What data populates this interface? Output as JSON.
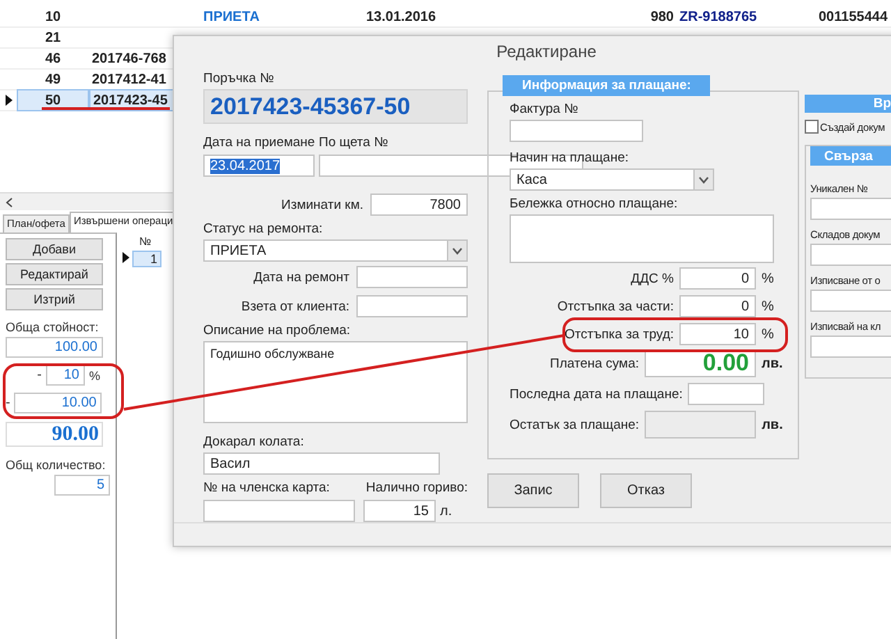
{
  "orders_table": {
    "rows": [
      {
        "number": "10",
        "status": "ПРИЕТА",
        "date": "13.01.2016",
        "column_5": "980",
        "column_6": "ZR-9188765",
        "column_7": "001155444",
        "selected": false
      },
      {
        "number": "21",
        "selected": false
      },
      {
        "number": "46",
        "order": "201746-768",
        "selected": false
      },
      {
        "number": "49",
        "order": "2017412-41",
        "selected": false
      },
      {
        "number": "50",
        "order": "2017423-45",
        "selected": true
      }
    ]
  },
  "bottom_tabs": [
    {
      "label": "План/офета",
      "selected": false
    },
    {
      "label": "Извършени операци",
      "selected": true
    }
  ],
  "operations_panel": {
    "buttons": [
      "Добави",
      "Редактирай",
      "Изтрий"
    ],
    "total_label": "Обща стойност:",
    "total": "100.00",
    "percent_minus": "-",
    "discount_percent": "10",
    "percent_sign": "%",
    "amount_minus": "-",
    "discount_amount": "10.00",
    "net_total": "90.00",
    "quantity_label": "Общ количество:",
    "quantity": "5"
  },
  "operations_grid": {
    "header": "№",
    "rows": [
      {
        "number": "1",
        "selected": true
      }
    ]
  },
  "dialog": {
    "title": "Редактиране",
    "order": {
      "label": "Поръчка №",
      "value": "2017423-45367-50"
    },
    "intake_date": {
      "label": "Дата на приемане",
      "value": "23.04.2017",
      "text_selected": true
    },
    "claim": {
      "label": "По щета №"
    },
    "mileage": {
      "label": "Изминати км.",
      "value": "7800"
    },
    "repair_status": {
      "label": "Статус на ремонта:",
      "value": "ПРИЕТА"
    },
    "repair_date": {
      "label": "Дата на ремонт"
    },
    "picked_up": {
      "label": "Взета от клиента:"
    },
    "problem": {
      "label": "Описание на проблема:",
      "value": "Годишно обслужване"
    },
    "driver": {
      "label": "Докарал колата:",
      "value": "Васил"
    },
    "member_card": {
      "label": "№ на членска карта:"
    },
    "fuel": {
      "label": "Налично гориво:",
      "value": "15",
      "unit": "л."
    },
    "payment": {
      "title": "Информация за плащане:",
      "invoice": {
        "label": "Фактура №"
      },
      "method": {
        "label": "Начин на плащане:",
        "value": "Каса"
      },
      "note": {
        "label": "Бележка относно плащане:"
      },
      "rows": [
        {
          "kind": "percent",
          "label": "ДДС %",
          "value": "0",
          "unit": "%"
        },
        {
          "kind": "percent",
          "label": "Отстъпка за части:",
          "value": "0",
          "unit": "%"
        },
        {
          "kind": "percent",
          "label": "Отстъпка за труд:",
          "value": "10",
          "unit": "%"
        },
        {
          "kind": "paid",
          "label": "Платена сума:",
          "value": "0.00",
          "unit": "лв."
        },
        {
          "kind": "date",
          "label": "Последна дата на плащане:"
        },
        {
          "kind": "remaining",
          "label": "Остатък за плащане:",
          "unit": "лв."
        }
      ]
    },
    "buttons": [
      "Запис",
      "Отказ"
    ],
    "side": {
      "header": "Вр",
      "create_doc": {
        "label": "Създай докум",
        "checked": false
      },
      "linked": {
        "title": "Свърза",
        "fields": [
          "Уникален №",
          "Складов докум",
          "Изписване от о",
          "Изписвай на кл"
        ]
      }
    }
  }
}
